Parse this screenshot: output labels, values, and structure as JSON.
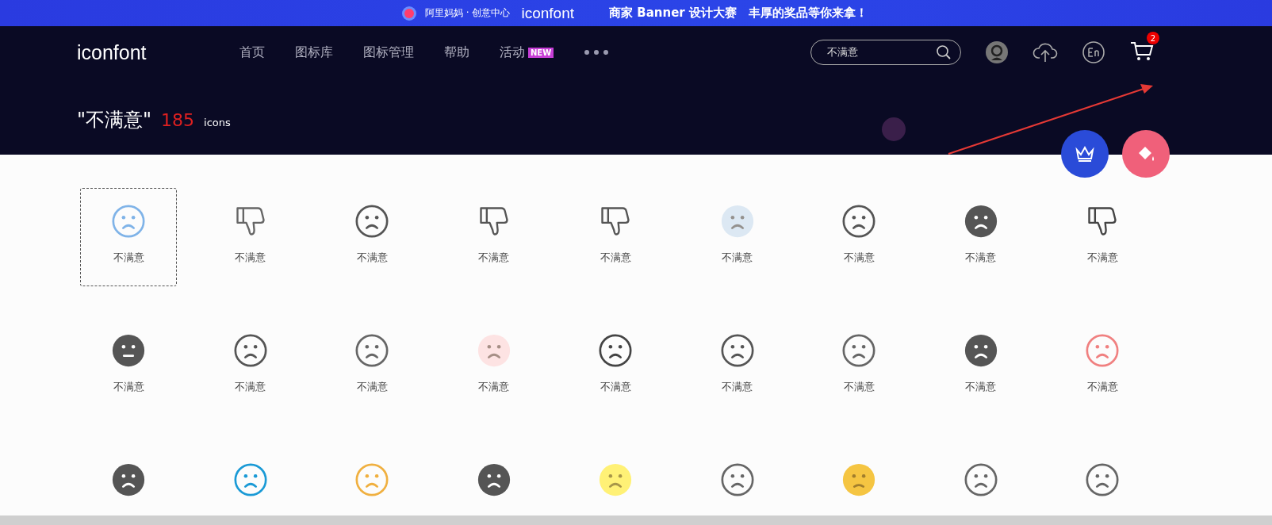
{
  "banner": {
    "brand": "阿里妈妈 · 创意中心",
    "logo": "iconfont",
    "text": "商家 Banner 设计大赛　丰厚的奖品等你来拿！"
  },
  "header": {
    "logo": "iconfont",
    "nav": [
      {
        "label": "首页"
      },
      {
        "label": "图标库"
      },
      {
        "label": "图标管理"
      },
      {
        "label": "帮助"
      },
      {
        "label": "活动",
        "badge": "NEW"
      }
    ],
    "search": {
      "value": "不满意"
    },
    "cart_count": "2"
  },
  "result": {
    "query": "\"不满意\"",
    "count": "185",
    "unit": "icons"
  },
  "icons": [
    {
      "kind": "outline",
      "color": "#7fb3e8",
      "label": "不满意",
      "selected": true
    },
    {
      "kind": "thumb",
      "color": "#666666",
      "label": "不满意",
      "selected": false
    },
    {
      "kind": "outline",
      "color": "#555555",
      "label": "不满意",
      "selected": false
    },
    {
      "kind": "thumb",
      "color": "#555555",
      "label": "不满意",
      "selected": false
    },
    {
      "kind": "thumb",
      "color": "#555555",
      "label": "不满意",
      "selected": false
    },
    {
      "kind": "tint",
      "color": "#dce8f3",
      "label": "不满意",
      "selected": false
    },
    {
      "kind": "outline",
      "color": "#555555",
      "label": "不满意",
      "selected": false
    },
    {
      "kind": "filled",
      "color": "#555555",
      "label": "不满意",
      "selected": false
    },
    {
      "kind": "thumb",
      "color": "#444444",
      "label": "不满意",
      "selected": false
    },
    {
      "kind": "filled-flat",
      "color": "#555555",
      "label": "不满意",
      "selected": false
    },
    {
      "kind": "outline",
      "color": "#555555",
      "label": "不满意",
      "selected": false
    },
    {
      "kind": "outline",
      "color": "#666666",
      "label": "不满意",
      "selected": false
    },
    {
      "kind": "tint",
      "color": "#fde3e3",
      "label": "不满意",
      "selected": false
    },
    {
      "kind": "outline",
      "color": "#444444",
      "label": "不满意",
      "selected": false
    },
    {
      "kind": "outline",
      "color": "#555555",
      "label": "不满意",
      "selected": false
    },
    {
      "kind": "outline",
      "color": "#666666",
      "label": "不满意",
      "selected": false
    },
    {
      "kind": "filled",
      "color": "#555555",
      "label": "不满意",
      "selected": false
    },
    {
      "kind": "outline",
      "color": "#f08080",
      "label": "不满意",
      "selected": false
    },
    {
      "kind": "filled",
      "color": "#555555",
      "selected": false
    },
    {
      "kind": "outline",
      "color": "#1a9ad6",
      "selected": false
    },
    {
      "kind": "outline",
      "color": "#f0b040",
      "selected": false
    },
    {
      "kind": "filled",
      "color": "#555555",
      "selected": false
    },
    {
      "kind": "tint",
      "color": "#fff176",
      "selected": false
    },
    {
      "kind": "outline",
      "color": "#666666",
      "selected": false
    },
    {
      "kind": "tint-angry",
      "color": "#f5c542",
      "selected": false
    },
    {
      "kind": "outline",
      "color": "#666666",
      "selected": false
    },
    {
      "kind": "outline",
      "color": "#666666",
      "selected": false
    }
  ]
}
